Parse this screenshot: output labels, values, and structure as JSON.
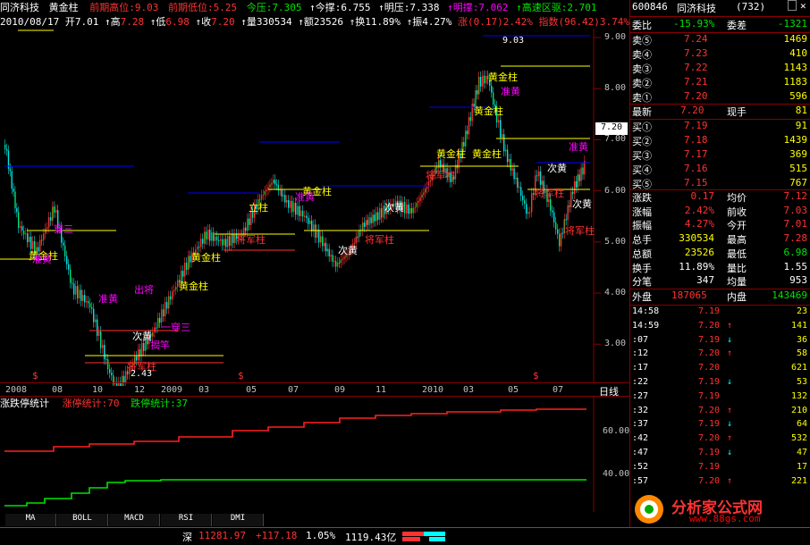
{
  "header": {
    "stock_name": "同济科技",
    "indicator": "黄金柱",
    "prev_high_label": "前期高位:",
    "prev_high": "9.03",
    "prev_low_label": "前期低位:",
    "prev_low": "5.25",
    "today_press_label": "今压:",
    "today_press": "7.305",
    "today_support_label": "↑今撑:",
    "today_support": "6.755",
    "tomorrow_press_label": "↑明压:",
    "tomorrow_press": "7.338",
    "tomorrow_support_label": "↑明撑:",
    "tomorrow_support": "7.062",
    "trend_label": "↑高速区驱:",
    "trend": "2.701"
  },
  "info": {
    "date": "2010/08/17",
    "open_label": "开",
    "open": "7.01",
    "high_label": "↑高",
    "high": "7.28",
    "low_label": "↑低",
    "low": "6.98",
    "close_label": "↑收",
    "close": "7.20",
    "vol_label": "↑量",
    "vol": "330534",
    "amt_label": "↑额",
    "amt": "23526",
    "turn_label": "↑换",
    "turn": "11.89%",
    "amp_label": "↑振",
    "amp": "4.27%",
    "chg_label": "涨",
    "chg": "(0.17)",
    "chg_pct": "2.42%",
    "idx_label": "指数",
    "idx": "(96.42)",
    "idx_pct": "3.74%"
  },
  "main_chart": {
    "price_axis": [
      "9.00",
      "8.00",
      "7.00",
      "6.00",
      "5.00",
      "4.00",
      "3.00"
    ],
    "current_price_tag": "7.20",
    "high_mark": "9.03",
    "low_mark": "2.43",
    "annotations": [
      {
        "text": "黄金柱",
        "color": "#ffff00"
      },
      {
        "text": "将军柱",
        "color": "#ff3232"
      },
      {
        "text": "次黄",
        "color": "#ffffff"
      },
      {
        "text": "准黄",
        "color": "#ff00ff"
      },
      {
        "text": "穿三",
        "color": "#ff00ff"
      },
      {
        "text": "一穿三",
        "color": "#ff00ff"
      },
      {
        "text": "揭竿",
        "color": "#ff00ff"
      },
      {
        "text": "立柱",
        "color": "#ffff00"
      },
      {
        "text": "出将",
        "color": "#ff00ff"
      }
    ],
    "x_labels": [
      "2008",
      "08",
      "10",
      "12",
      "2009",
      "03",
      "05",
      "07",
      "09",
      "11",
      "2010",
      "03",
      "05",
      "07"
    ],
    "cycle_label": "日线"
  },
  "indicator_chart": {
    "title": "涨跌停统计",
    "up_label": "涨停统计:",
    "up_value": "70",
    "down_label": "跌停统计:",
    "down_value": "37",
    "axis": [
      "60.00",
      "40.00"
    ]
  },
  "tabs": [
    "MA",
    "BOLL",
    "MACD",
    "RSI",
    "DMI"
  ],
  "status": {
    "market": "深",
    "index": "11281.97",
    "change": "+117.18",
    "pct": "1.05%",
    "amount": "1119.43亿"
  },
  "quote": {
    "code": "600846",
    "name": "同济科技",
    "count": "(732)",
    "weibi_label": "委比",
    "weibi": "-15.93%",
    "weicha_label": "委差",
    "weicha": "-1321",
    "asks": [
      {
        "label": "卖⑤",
        "price": "7.24",
        "vol": "1469"
      },
      {
        "label": "卖④",
        "price": "7.23",
        "vol": "410"
      },
      {
        "label": "卖③",
        "price": "7.22",
        "vol": "1143"
      },
      {
        "label": "卖②",
        "price": "7.21",
        "vol": "1183"
      },
      {
        "label": "卖①",
        "price": "7.20",
        "vol": "596"
      }
    ],
    "last_label": "最新",
    "last": "7.20",
    "cur_vol_label": "现手",
    "cur_vol": "81",
    "bids": [
      {
        "label": "买①",
        "price": "7.19",
        "vol": "91"
      },
      {
        "label": "买②",
        "price": "7.18",
        "vol": "1439"
      },
      {
        "label": "买③",
        "price": "7.17",
        "vol": "369"
      },
      {
        "label": "买④",
        "price": "7.16",
        "vol": "515"
      },
      {
        "label": "买⑤",
        "price": "7.15",
        "vol": "767"
      }
    ],
    "stats": [
      {
        "l1": "涨跌",
        "v1": "0.17",
        "l2": "均价",
        "v2": "7.12"
      },
      {
        "l1": "涨幅",
        "v1": "2.42%",
        "l2": "前收",
        "v2": "7.03"
      },
      {
        "l1": "振幅",
        "v1": "4.27%",
        "l2": "今开",
        "v2": "7.01"
      },
      {
        "l1": "总手",
        "v1": "330534",
        "l2": "最高",
        "v2": "7.28"
      },
      {
        "l1": "总额",
        "v1": "23526",
        "l2": "最低",
        "v2": "6.98"
      },
      {
        "l1": "换手",
        "v1": "11.89%",
        "l2": "量比",
        "v2": "1.55"
      },
      {
        "l1": "分笔",
        "v1": "347",
        "l2": "均量",
        "v2": "953"
      }
    ],
    "outer_label": "外盘",
    "outer": "187065",
    "inner_label": "内盘",
    "inner": "143469",
    "ticks": [
      {
        "t": "14:58",
        "p": "7.19",
        "a": "",
        "v": "23"
      },
      {
        "t": "14:59",
        "p": "7.20",
        "a": "↑",
        "v": "141"
      },
      {
        "t": ":07",
        "p": "7.19",
        "a": "↓",
        "v": "36"
      },
      {
        "t": ":12",
        "p": "7.20",
        "a": "↑",
        "v": "58"
      },
      {
        "t": ":17",
        "p": "7.20",
        "a": "",
        "v": "621"
      },
      {
        "t": ":22",
        "p": "7.19",
        "a": "↓",
        "v": "53"
      },
      {
        "t": ":27",
        "p": "7.19",
        "a": "",
        "v": "132"
      },
      {
        "t": ":32",
        "p": "7.20",
        "a": "↑",
        "v": "210"
      },
      {
        "t": ":37",
        "p": "7.19",
        "a": "↓",
        "v": "64"
      },
      {
        "t": ":42",
        "p": "7.20",
        "a": "↑",
        "v": "532"
      },
      {
        "t": ":47",
        "p": "7.19",
        "a": "↓",
        "v": "47"
      },
      {
        "t": ":52",
        "p": "7.19",
        "a": "",
        "v": "17"
      },
      {
        "t": ":57",
        "p": "7.20",
        "a": "↑",
        "v": "221"
      }
    ],
    "logo_text": "分析家公式网",
    "logo_url": "www.88gs.com"
  }
}
